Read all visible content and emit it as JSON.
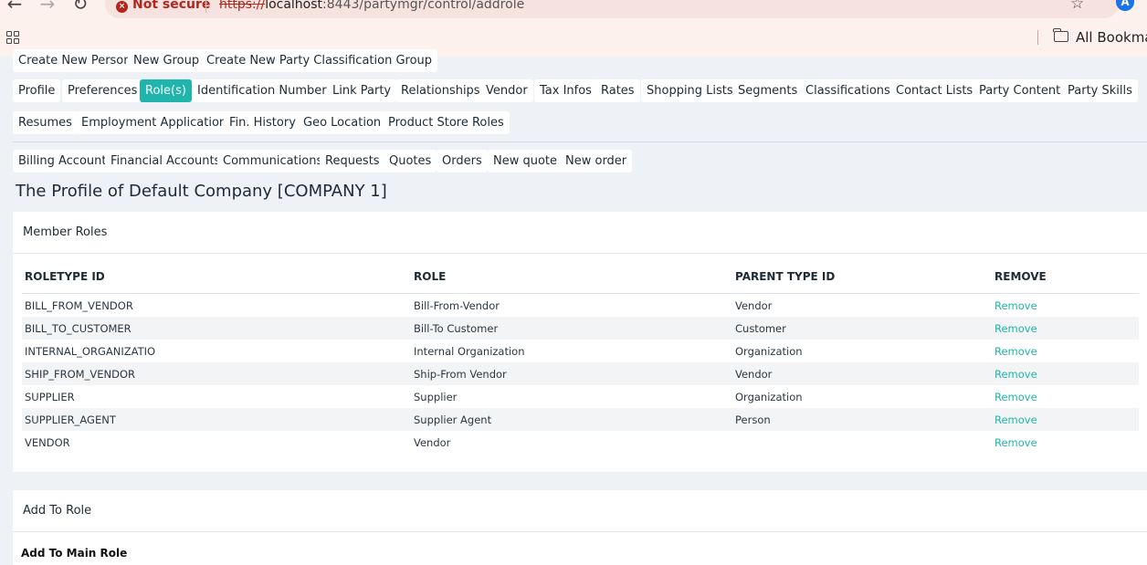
{
  "browser": {
    "security_label": "Not secure",
    "url_scheme": "https://",
    "url_host": "localhost",
    "url_rest": ":8443/partymgr/control/addrole",
    "profile_initial": "A",
    "bookmarks_label": "All Bookma"
  },
  "create_links": [
    "Create New Person",
    "New Group",
    "Create New Party Classification Group"
  ],
  "tabs_row1": [
    "Profile",
    "Preferences",
    "Role(s)",
    "Identification Numbers",
    "Link Party",
    "Relationships",
    "Vendor",
    "Tax Infos",
    "Rates",
    "Shopping Lists",
    "Segments",
    "Classifications",
    "Contact Lists",
    "Party Content",
    "Party Skills"
  ],
  "active_tab": "Role(s)",
  "tabs_row2": [
    "Resumes",
    "Employment Applications",
    "Fin. History",
    "Geo Location",
    "Product Store Roles"
  ],
  "tabs_row3": [
    "Billing Account",
    "Financial Accounts",
    "Communications",
    "Requests",
    "Quotes",
    "Orders",
    "New quote",
    "New order"
  ],
  "page_title": "The Profile of Default Company [COMPANY 1]",
  "member_roles": {
    "title": "Member Roles",
    "columns": [
      "ROLETYPE ID",
      "ROLE",
      "PARENT TYPE ID",
      "REMOVE"
    ],
    "rows": [
      {
        "roletype_id": "BILL_FROM_VENDOR",
        "role": "Bill-From-Vendor",
        "parent": "Vendor",
        "action": "Remove"
      },
      {
        "roletype_id": "BILL_TO_CUSTOMER",
        "role": "Bill-To Customer",
        "parent": "Customer",
        "action": "Remove"
      },
      {
        "roletype_id": "INTERNAL_ORGANIZATIO",
        "role": "Internal Organization",
        "parent": "Organization",
        "action": "Remove"
      },
      {
        "roletype_id": "SHIP_FROM_VENDOR",
        "role": "Ship-From Vendor",
        "parent": "Vendor",
        "action": "Remove"
      },
      {
        "roletype_id": "SUPPLIER",
        "role": "Supplier",
        "parent": "Organization",
        "action": "Remove"
      },
      {
        "roletype_id": "SUPPLIER_AGENT",
        "role": "Supplier Agent",
        "parent": "Person",
        "action": "Remove"
      },
      {
        "roletype_id": "VENDOR",
        "role": "Vendor",
        "parent": "",
        "action": "Remove"
      }
    ]
  },
  "add_to_role": {
    "title": "Add To Role",
    "subheading": "Add To Main Role"
  },
  "colors": {
    "accent": "#1fb5ac",
    "insecure": "#b3261e"
  },
  "icons": [
    "back-arrow-icon",
    "forward-arrow-icon",
    "reload-icon",
    "warning-icon",
    "star-icon",
    "apps-grid-icon",
    "folder-icon"
  ]
}
